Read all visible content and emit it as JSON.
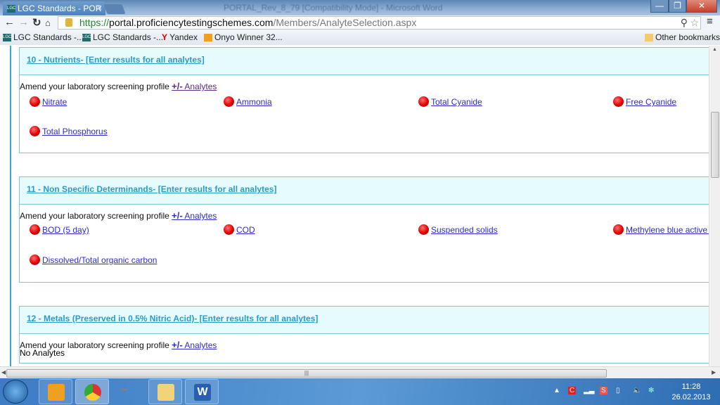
{
  "browser": {
    "tab_title": "LGC Standards - POR",
    "background_window_title": "PORTAL_Rev_8_79 [Compatibility Mode] - Microsoft Word",
    "url_scheme": "https://",
    "url_host": "portal.proficiencytestingschemes.com",
    "url_path": "/Members/AnalyteSelection.aspx",
    "bookmarks": [
      {
        "label": "LGC Standards -...",
        "icon": "lgc-icon"
      },
      {
        "label": "LGC Standards -...",
        "icon": "lgc-icon"
      },
      {
        "label": "Yandex",
        "icon": "yandex-icon"
      },
      {
        "label": "Onyo Winner 32...",
        "icon": "onyo-icon"
      }
    ],
    "other_bookmarks": "Other bookmarks"
  },
  "amend_text": "Amend your laboratory screening profile",
  "plus_minus": "+/-",
  "analytes_link": "Analytes",
  "sections": [
    {
      "title": "10 - Nutrients- [Enter results for all analytes]",
      "analytes": [
        "Nitrate",
        "Ammonia",
        "Total Cyanide",
        "Free Cyanide",
        "Total Phosphorus"
      ],
      "visited": true
    },
    {
      "title": "11 - Non Specific Determinands- [Enter results for all analytes]",
      "analytes": [
        "BOD (5 day)",
        "COD",
        "Suspended solids",
        "Methylene blue active s",
        "Dissolved/Total organic carbon"
      ],
      "visited": false
    },
    {
      "title": "12 - Metals (Preserved in 0.5% Nitric Acid)- [Enter results for all analytes]",
      "analytes": [],
      "no_analytes": "No Analytes",
      "visited": false
    }
  ],
  "status_color": "#e00000",
  "taskbar": {
    "apps": [
      "outlook",
      "chrome",
      "unknown",
      "explorer",
      "word"
    ],
    "time": "11:28",
    "date": "26.02.2013"
  }
}
